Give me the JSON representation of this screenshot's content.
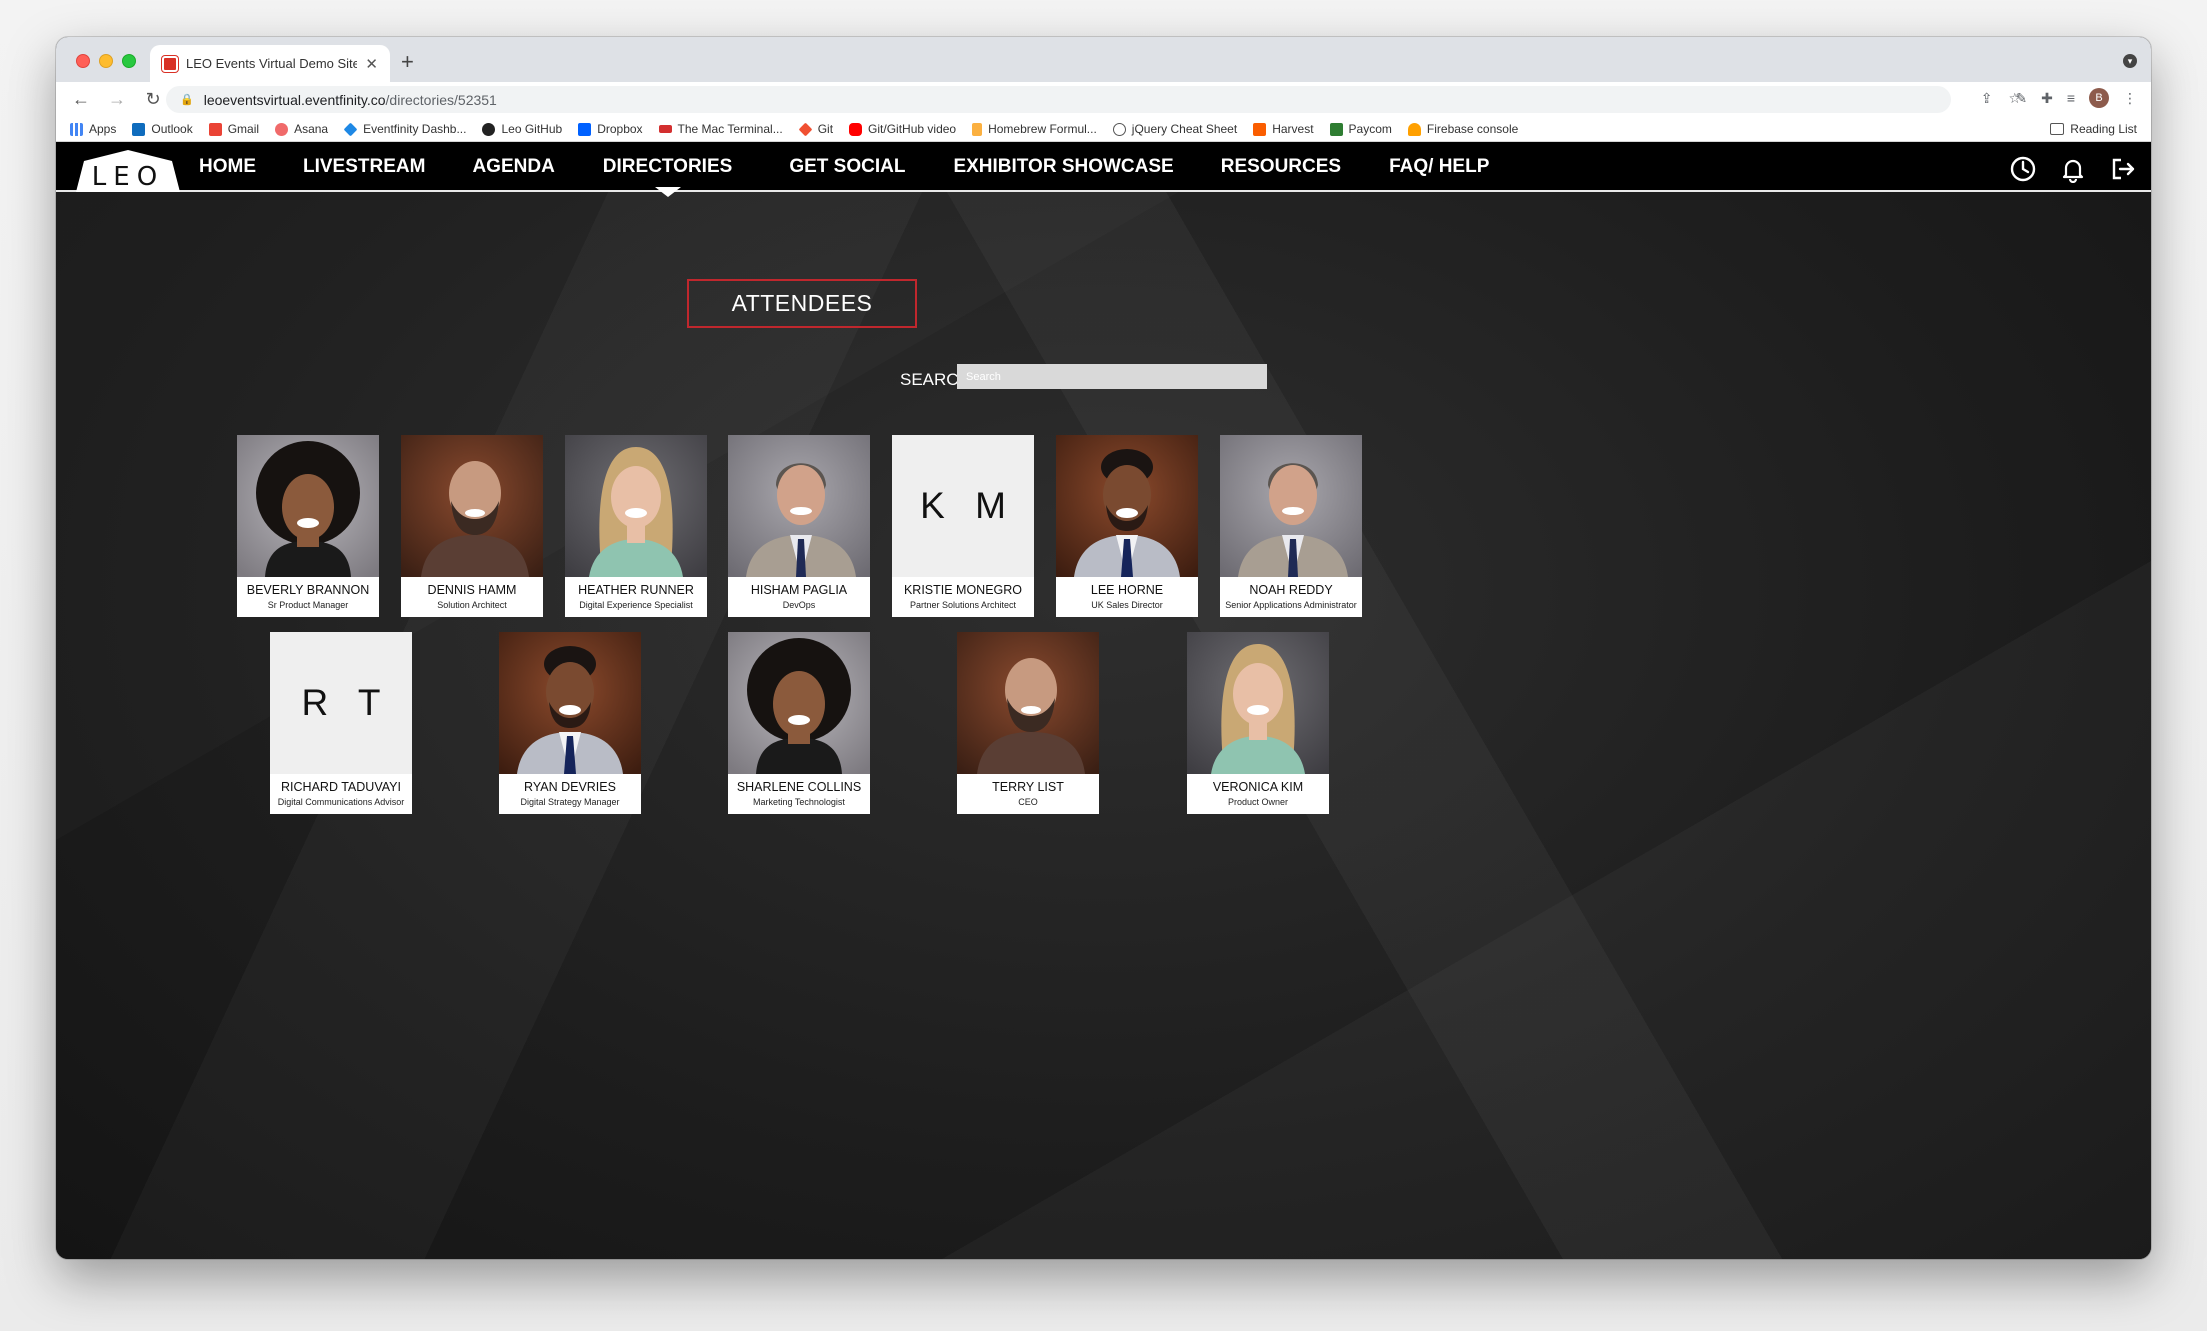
{
  "browser": {
    "tab_title": "LEO Events Virtual Demo Site",
    "url_host": "leoeventsvirtual.eventfinity.co",
    "url_path": "/directories/52351",
    "profile_initial": "B",
    "bookmarks": [
      "Apps",
      "Outlook",
      "Gmail",
      "Asana",
      "Eventfinity Dashb...",
      "Leo GitHub",
      "Dropbox",
      "The Mac Terminal...",
      "Git",
      "Git/GitHub video",
      "Homebrew Formul...",
      "jQuery Cheat Sheet",
      "Harvest",
      "Paycom",
      "Firebase console"
    ],
    "reading_list": "Reading List"
  },
  "site": {
    "logo": "LEO",
    "menu": [
      "HOME",
      "LIVESTREAM",
      "AGENDA",
      "DIRECTORIES",
      "GET SOCIAL",
      "EXHIBITOR SHOWCASE",
      "RESOURCES",
      "FAQ/ HELP"
    ],
    "active_menu": "DIRECTORIES",
    "page_title": "ATTENDEES",
    "search_label": "SEARCH",
    "search_placeholder": "Search"
  },
  "attendees": [
    {
      "name": "BEVERLY BRANNON",
      "title": "Sr Product Manager",
      "avatar": "woman-afro-photo"
    },
    {
      "name": "DENNIS HAMM",
      "title": "Solution Architect",
      "avatar": "bald-man-beard-photo"
    },
    {
      "name": "HEATHER RUNNER",
      "title": "Digital Experience Specialist",
      "avatar": "blonde-woman-photo"
    },
    {
      "name": "HISHAM PAGLIA",
      "title": "DevOps",
      "avatar": "gray-hair-man-suit-photo"
    },
    {
      "name": "KRISTIE MONEGRO",
      "title": "Partner Solutions Architect",
      "initials": "K M"
    },
    {
      "name": "LEE HORNE",
      "title": "UK Sales Director",
      "avatar": "man-suit-smiling-photo"
    },
    {
      "name": "NOAH REDDY",
      "title": "Senior Applications Administrator",
      "avatar": "gray-hair-man-suit-photo"
    },
    {
      "name": "RICHARD TADUVAYI",
      "title": "Digital Communications Advisor",
      "initials": "R T"
    },
    {
      "name": "RYAN DEVRIES",
      "title": "Digital Strategy Manager",
      "avatar": "man-suit-smiling-photo"
    },
    {
      "name": "SHARLENE COLLINS",
      "title": "Marketing Technologist",
      "avatar": "woman-afro-photo"
    },
    {
      "name": "TERRY LIST",
      "title": "CEO",
      "avatar": "bald-man-beard-photo"
    },
    {
      "name": "VERONICA KIM",
      "title": "Product Owner",
      "avatar": "blonde-woman-photo"
    }
  ]
}
